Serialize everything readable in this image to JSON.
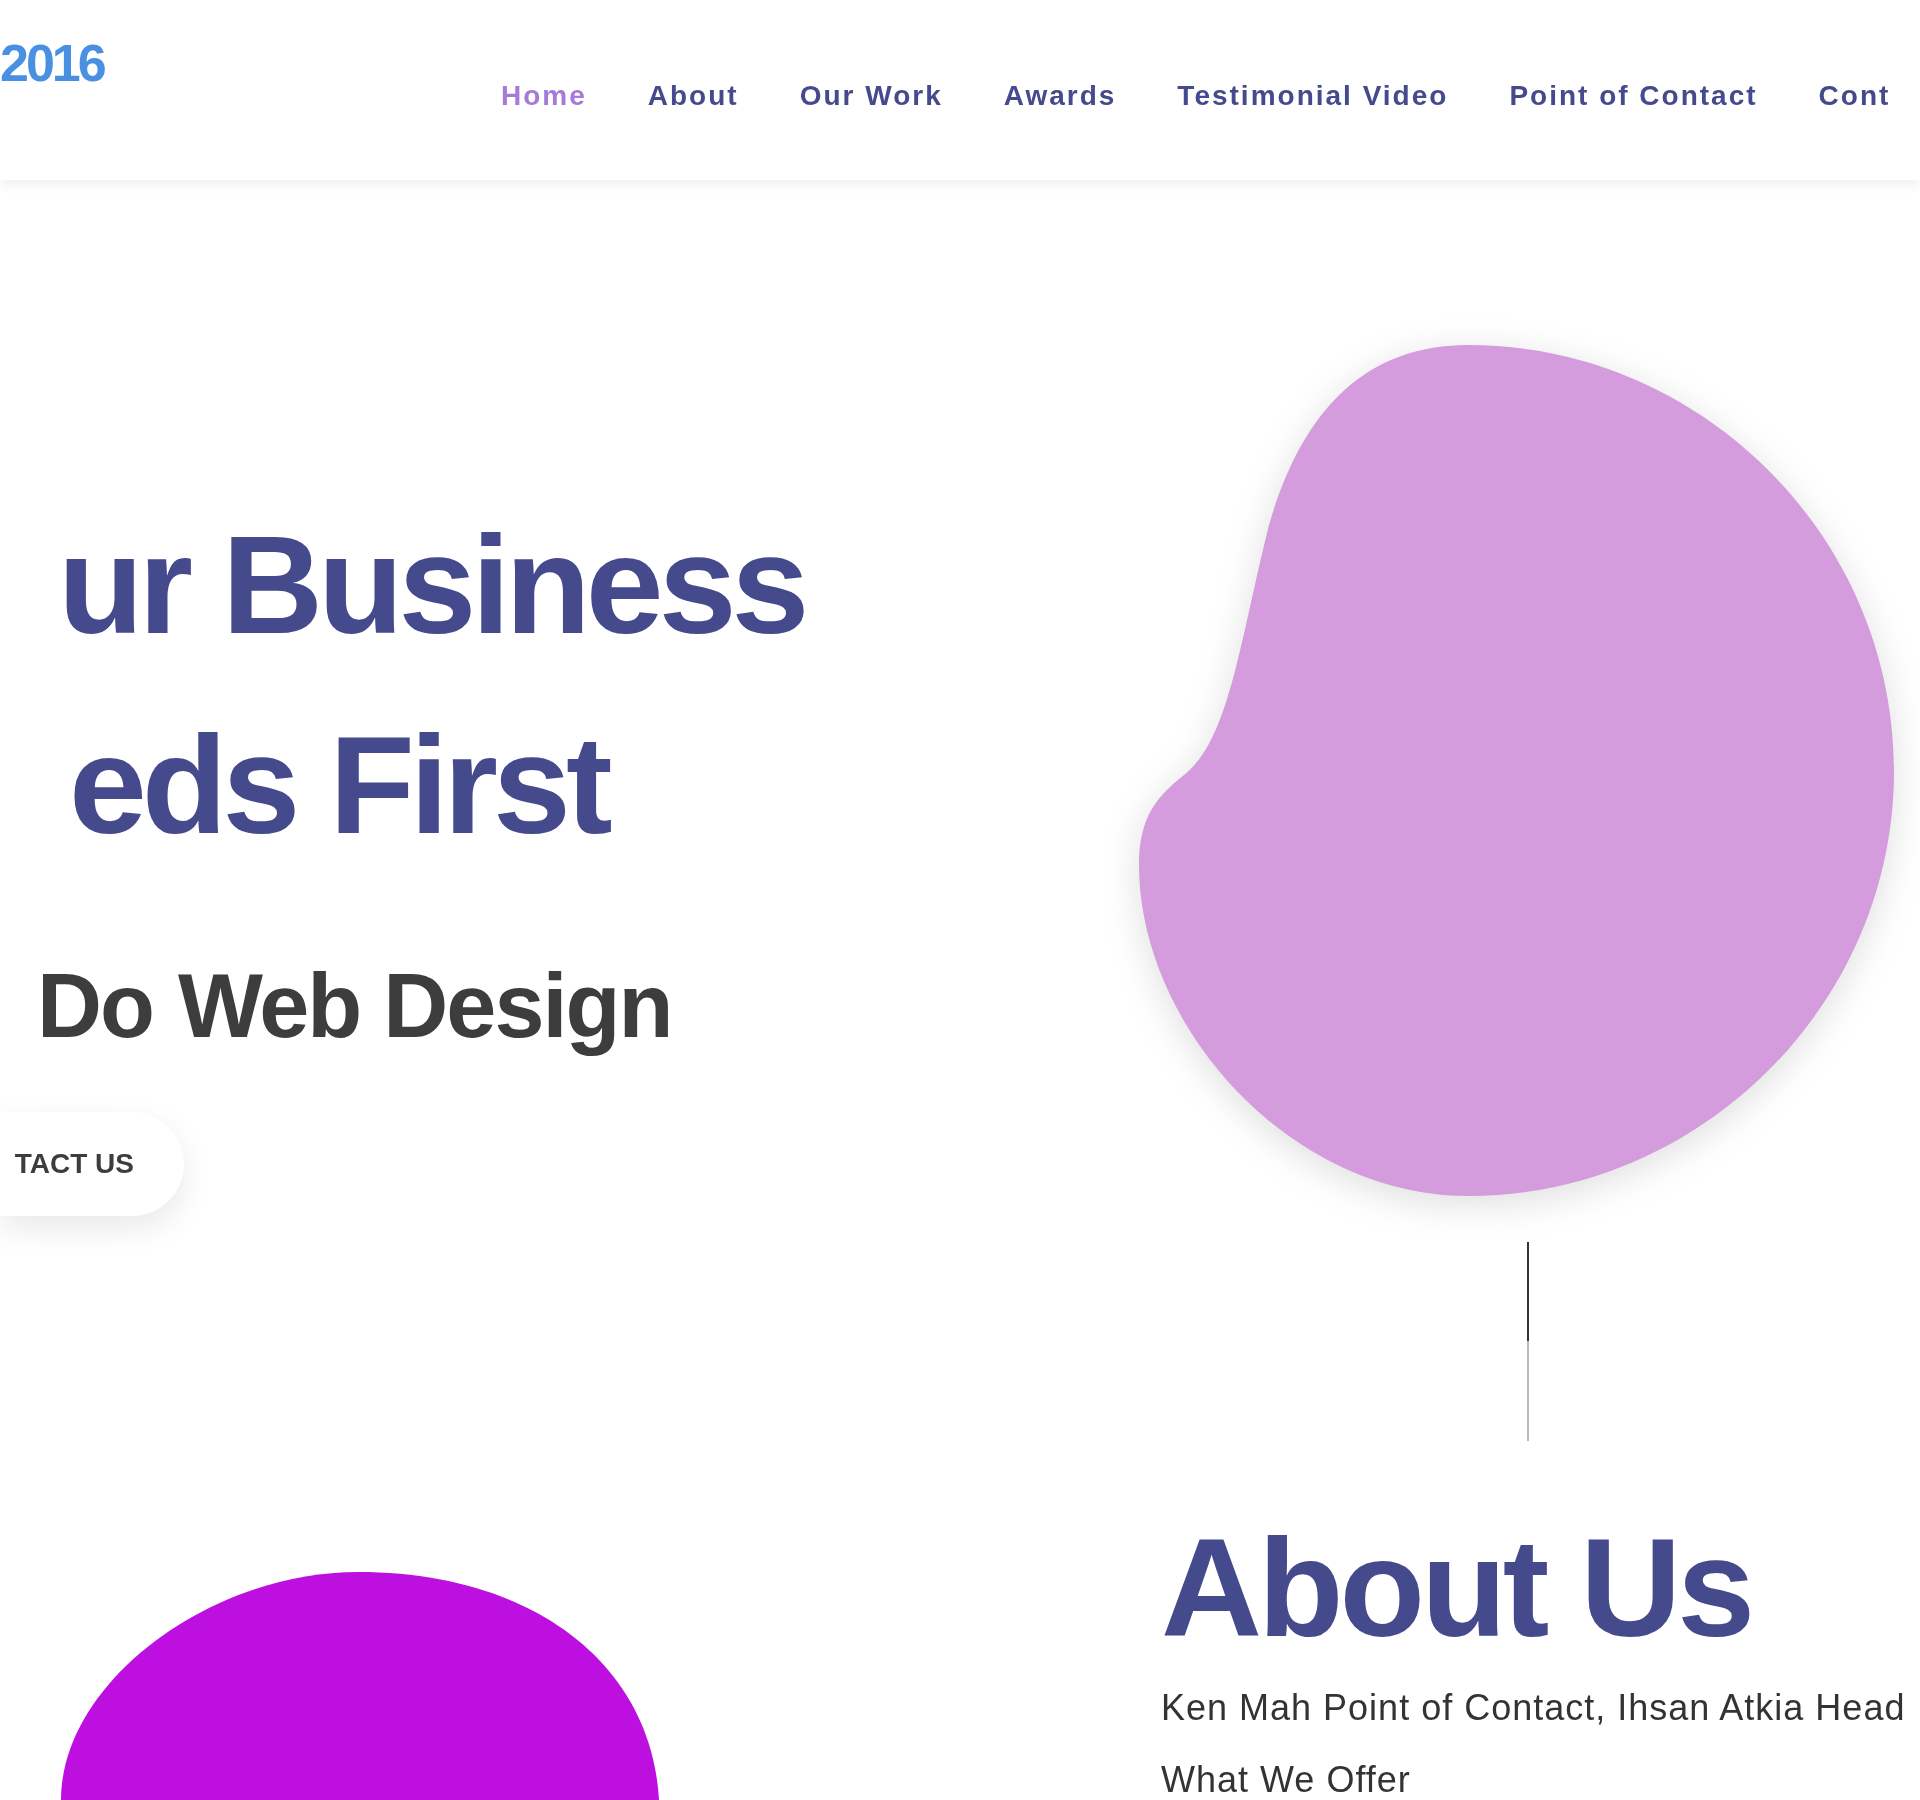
{
  "header": {
    "logo": "2016",
    "nav": [
      {
        "label": "Home",
        "selected": true
      },
      {
        "label": "About",
        "selected": false
      },
      {
        "label": "Our Work",
        "selected": false
      },
      {
        "label": "Awards",
        "selected": false
      },
      {
        "label": "Testimonial Video",
        "selected": false
      },
      {
        "label": "Point of Contact",
        "selected": false
      },
      {
        "label": "Cont",
        "selected": false
      }
    ]
  },
  "hero": {
    "heading_lines": [
      "ur Business",
      "eds First"
    ],
    "tagline": [
      "Do",
      "Web Design"
    ],
    "button": "TACT US"
  },
  "about": {
    "heading": "About Us",
    "text": "Ken Mah Point of Contact, Ihsan Atkia Head",
    "subheading": "What We Offer"
  }
}
